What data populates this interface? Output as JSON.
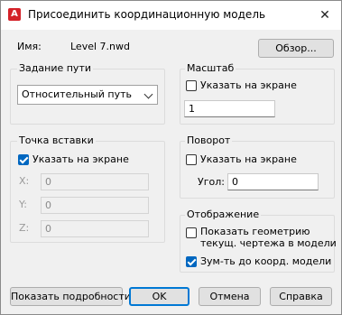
{
  "window": {
    "title": "Присоединить координационную модель",
    "close_glyph": "✕",
    "app_icon_letter": "A"
  },
  "name": {
    "label": "Имя:",
    "value": "Level 7.nwd",
    "browse_button": "Обзор..."
  },
  "path": {
    "group_label": "Задание пути",
    "selected": "Относительный путь"
  },
  "scale": {
    "group_label": "Масштаб",
    "specify_on_screen": "Указать на экране",
    "specify_checked": false,
    "value": "1"
  },
  "insertion": {
    "group_label": "Точка вставки",
    "specify_on_screen": "Указать на экране",
    "specify_checked": true,
    "x_label": "X:",
    "x_value": "0",
    "y_label": "Y:",
    "y_value": "0",
    "z_label": "Z:",
    "z_value": "0"
  },
  "rotation": {
    "group_label": "Поворот",
    "specify_on_screen": "Указать на экране",
    "specify_checked": false,
    "angle_label": "Угол:",
    "angle_value": "0"
  },
  "display": {
    "group_label": "Отображение",
    "show_geometry_line1": "Показать геометрию",
    "show_geometry_line2": "текущ. чертежа в модели",
    "show_geometry_checked": false,
    "zoom_label": "Зум-ть до коорд. модели",
    "zoom_checked": true
  },
  "footer": {
    "details_button": "Показать подробности",
    "ok_button": "OK",
    "cancel_button": "Отмена",
    "help_button": "Справка"
  }
}
